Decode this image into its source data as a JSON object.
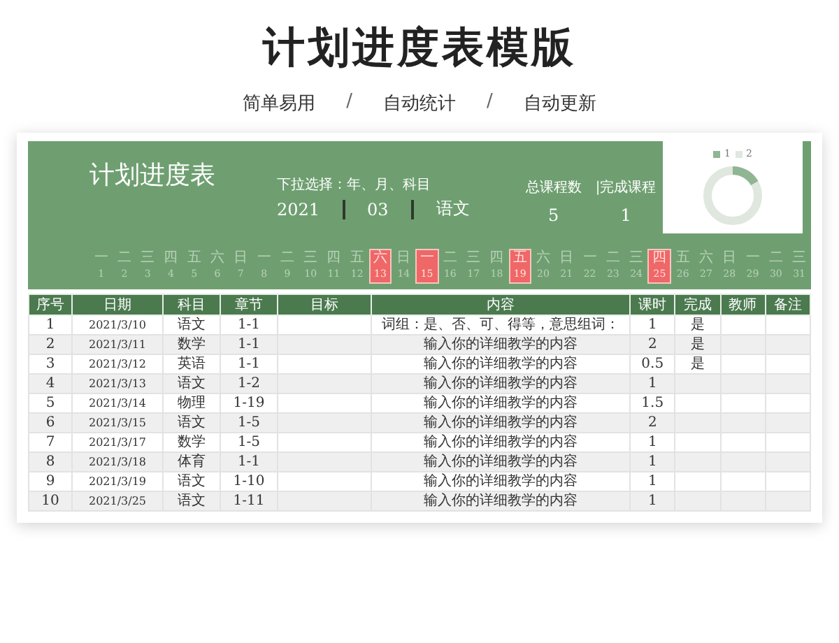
{
  "page": {
    "title": "计划进度表模版",
    "features": [
      "简单易用",
      "自动统计",
      "自动更新"
    ],
    "separator": "/"
  },
  "sheet": {
    "title": "计划进度表",
    "selector": {
      "label": "下拉选择：年、月、科目",
      "year": "2021",
      "month": "03",
      "subject": "语文"
    },
    "stats": [
      {
        "label": "总课程数",
        "value": "5"
      },
      {
        "label": "|完成课程",
        "value": "1"
      }
    ],
    "chart": {
      "legend": [
        {
          "label": "1",
          "color": "#8fb592"
        },
        {
          "label": "2",
          "color": "#dfe7df"
        }
      ]
    },
    "calendar": [
      {
        "weekday": "一",
        "day": "1",
        "highlighted": false
      },
      {
        "weekday": "二",
        "day": "2",
        "highlighted": false
      },
      {
        "weekday": "三",
        "day": "3",
        "highlighted": false
      },
      {
        "weekday": "四",
        "day": "4",
        "highlighted": false
      },
      {
        "weekday": "五",
        "day": "5",
        "highlighted": false
      },
      {
        "weekday": "六",
        "day": "6",
        "highlighted": false
      },
      {
        "weekday": "日",
        "day": "7",
        "highlighted": false
      },
      {
        "weekday": "一",
        "day": "8",
        "highlighted": false
      },
      {
        "weekday": "二",
        "day": "9",
        "highlighted": false
      },
      {
        "weekday": "三",
        "day": "10",
        "highlighted": false
      },
      {
        "weekday": "四",
        "day": "11",
        "highlighted": false
      },
      {
        "weekday": "五",
        "day": "12",
        "highlighted": false
      },
      {
        "weekday": "六",
        "day": "13",
        "highlighted": true
      },
      {
        "weekday": "日",
        "day": "14",
        "highlighted": false
      },
      {
        "weekday": "一",
        "day": "15",
        "highlighted": true
      },
      {
        "weekday": "二",
        "day": "16",
        "highlighted": false
      },
      {
        "weekday": "三",
        "day": "17",
        "highlighted": false
      },
      {
        "weekday": "四",
        "day": "18",
        "highlighted": false
      },
      {
        "weekday": "五",
        "day": "19",
        "highlighted": true
      },
      {
        "weekday": "六",
        "day": "20",
        "highlighted": false
      },
      {
        "weekday": "日",
        "day": "21",
        "highlighted": false
      },
      {
        "weekday": "一",
        "day": "22",
        "highlighted": false
      },
      {
        "weekday": "二",
        "day": "23",
        "highlighted": false
      },
      {
        "weekday": "三",
        "day": "24",
        "highlighted": false
      },
      {
        "weekday": "四",
        "day": "25",
        "highlighted": true
      },
      {
        "weekday": "五",
        "day": "26",
        "highlighted": false
      },
      {
        "weekday": "六",
        "day": "27",
        "highlighted": false
      },
      {
        "weekday": "日",
        "day": "28",
        "highlighted": false
      },
      {
        "weekday": "一",
        "day": "29",
        "highlighted": false
      },
      {
        "weekday": "二",
        "day": "30",
        "highlighted": false
      },
      {
        "weekday": "三",
        "day": "31",
        "highlighted": false
      }
    ],
    "table": {
      "columns": [
        "序号",
        "日期",
        "科目",
        "章节",
        "目标",
        "内容",
        "课时",
        "完成",
        "教师",
        "备注"
      ],
      "rows": [
        [
          "1",
          "2021/3/10",
          "语文",
          "1-1",
          "",
          "词组：是、否、可、得等，意思组词：",
          "1",
          "是",
          "",
          ""
        ],
        [
          "2",
          "2021/3/11",
          "数学",
          "1-1",
          "",
          "输入你的详细教学的内容",
          "2",
          "是",
          "",
          ""
        ],
        [
          "3",
          "2021/3/12",
          "英语",
          "1-1",
          "",
          "输入你的详细教学的内容",
          "0.5",
          "是",
          "",
          ""
        ],
        [
          "4",
          "2021/3/13",
          "语文",
          "1-2",
          "",
          "输入你的详细教学的内容",
          "1",
          "",
          "",
          ""
        ],
        [
          "5",
          "2021/3/14",
          "物理",
          "1-19",
          "",
          "输入你的详细教学的内容",
          "1.5",
          "",
          "",
          ""
        ],
        [
          "6",
          "2021/3/15",
          "语文",
          "1-5",
          "",
          "输入你的详细教学的内容",
          "2",
          "",
          "",
          ""
        ],
        [
          "7",
          "2021/3/17",
          "数学",
          "1-5",
          "",
          "输入你的详细教学的内容",
          "1",
          "",
          "",
          ""
        ],
        [
          "8",
          "2021/3/18",
          "体育",
          "1-1",
          "",
          "输入你的详细教学的内容",
          "1",
          "",
          "",
          ""
        ],
        [
          "9",
          "2021/3/19",
          "语文",
          "1-10",
          "",
          "输入你的详细教学的内容",
          "1",
          "",
          "",
          ""
        ],
        [
          "10",
          "2021/3/25",
          "语文",
          "1-11",
          "",
          "输入你的详细教学的内容",
          "1",
          "",
          "",
          ""
        ]
      ]
    }
  }
}
